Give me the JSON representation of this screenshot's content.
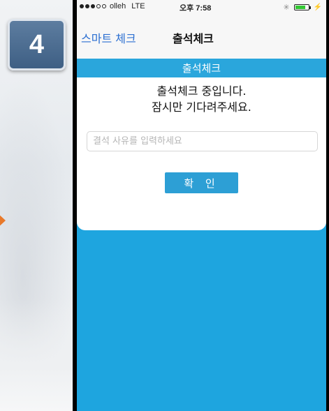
{
  "badge": {
    "step_number": "4"
  },
  "status_bar": {
    "carrier": "olleh",
    "network": "LTE",
    "time": "오후 7:58",
    "signal_bars": 3,
    "battery_level": 0.8
  },
  "nav": {
    "back_label": "스마트 체크",
    "title": "출석체크"
  },
  "section": {
    "header": "출석체크"
  },
  "content": {
    "message_line1": "출석체크 중입니다.",
    "message_line2": "잠시만 기다려주세요.",
    "reason_placeholder": "결석 사유를 입력하세요",
    "reason_value": "",
    "confirm_label": "확 인"
  },
  "colors": {
    "accent": "#1ea5df",
    "button": "#2d9fd5",
    "badge": "#4a6a90",
    "arrow": "#e8792a"
  }
}
